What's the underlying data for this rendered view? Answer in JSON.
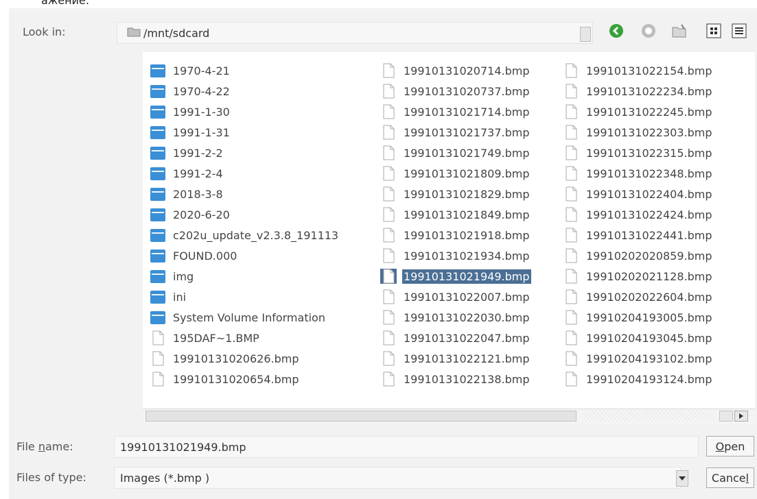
{
  "header_fragment": "ажение:",
  "dialog": {
    "look_in_label": "Look in:",
    "current_path": "/mnt/sdcard",
    "toolbar": [
      "back",
      "forward",
      "new-folder",
      "list-view",
      "detail-view"
    ]
  },
  "files": {
    "columns": [
      [
        {
          "name": "1970-4-21",
          "type": "folder"
        },
        {
          "name": "1970-4-22",
          "type": "folder"
        },
        {
          "name": "1991-1-30",
          "type": "folder"
        },
        {
          "name": "1991-1-31",
          "type": "folder"
        },
        {
          "name": "1991-2-2",
          "type": "folder"
        },
        {
          "name": "1991-2-4",
          "type": "folder"
        },
        {
          "name": "2018-3-8",
          "type": "folder"
        },
        {
          "name": "2020-6-20",
          "type": "folder"
        },
        {
          "name": "c202u_update_v2.3.8_191113",
          "type": "folder"
        },
        {
          "name": "FOUND.000",
          "type": "folder"
        },
        {
          "name": "img",
          "type": "folder"
        },
        {
          "name": "ini",
          "type": "folder"
        },
        {
          "name": "System Volume Information",
          "type": "folder"
        },
        {
          "name": "195DAF~1.BMP",
          "type": "file"
        },
        {
          "name": "19910131020626.bmp",
          "type": "file"
        },
        {
          "name": "19910131020654.bmp",
          "type": "file"
        }
      ],
      [
        {
          "name": "19910131020714.bmp",
          "type": "file"
        },
        {
          "name": "19910131020737.bmp",
          "type": "file"
        },
        {
          "name": "19910131021714.bmp",
          "type": "file"
        },
        {
          "name": "19910131021737.bmp",
          "type": "file"
        },
        {
          "name": "19910131021749.bmp",
          "type": "file"
        },
        {
          "name": "19910131021809.bmp",
          "type": "file"
        },
        {
          "name": "19910131021829.bmp",
          "type": "file"
        },
        {
          "name": "19910131021849.bmp",
          "type": "file"
        },
        {
          "name": "19910131021918.bmp",
          "type": "file"
        },
        {
          "name": "19910131021934.bmp",
          "type": "file"
        },
        {
          "name": "19910131021949.bmp",
          "type": "file",
          "selected": true
        },
        {
          "name": "19910131022007.bmp",
          "type": "file"
        },
        {
          "name": "19910131022030.bmp",
          "type": "file"
        },
        {
          "name": "19910131022047.bmp",
          "type": "file"
        },
        {
          "name": "19910131022121.bmp",
          "type": "file"
        },
        {
          "name": "19910131022138.bmp",
          "type": "file"
        }
      ],
      [
        {
          "name": "19910131022154.bmp",
          "type": "file"
        },
        {
          "name": "19910131022234.bmp",
          "type": "file"
        },
        {
          "name": "19910131022245.bmp",
          "type": "file"
        },
        {
          "name": "19910131022303.bmp",
          "type": "file"
        },
        {
          "name": "19910131022315.bmp",
          "type": "file"
        },
        {
          "name": "19910131022348.bmp",
          "type": "file"
        },
        {
          "name": "19910131022404.bmp",
          "type": "file"
        },
        {
          "name": "19910131022424.bmp",
          "type": "file"
        },
        {
          "name": "19910131022441.bmp",
          "type": "file"
        },
        {
          "name": "19910202020859.bmp",
          "type": "file"
        },
        {
          "name": "19910202021128.bmp",
          "type": "file"
        },
        {
          "name": "19910202022604.bmp",
          "type": "file"
        },
        {
          "name": "19910204193005.bmp",
          "type": "file"
        },
        {
          "name": "19910204193045.bmp",
          "type": "file"
        },
        {
          "name": "19910204193102.bmp",
          "type": "file"
        },
        {
          "name": "19910204193124.bmp",
          "type": "file"
        }
      ]
    ]
  },
  "filename": {
    "label_pre": "File ",
    "label_u": "n",
    "label_post": "ame:",
    "value": "19910131021949.bmp"
  },
  "filetype": {
    "label": "Files of type:",
    "value": "Images (*.bmp )"
  },
  "buttons": {
    "open_u": "O",
    "open_rest": "pen",
    "cancel_pre": "Cance",
    "cancel_u": "l"
  },
  "colors": {
    "folder": "#3a8fd6",
    "selection": "#4b6f95",
    "back_icon": "#3aa13a",
    "forward_icon": "#bdbdbd"
  }
}
